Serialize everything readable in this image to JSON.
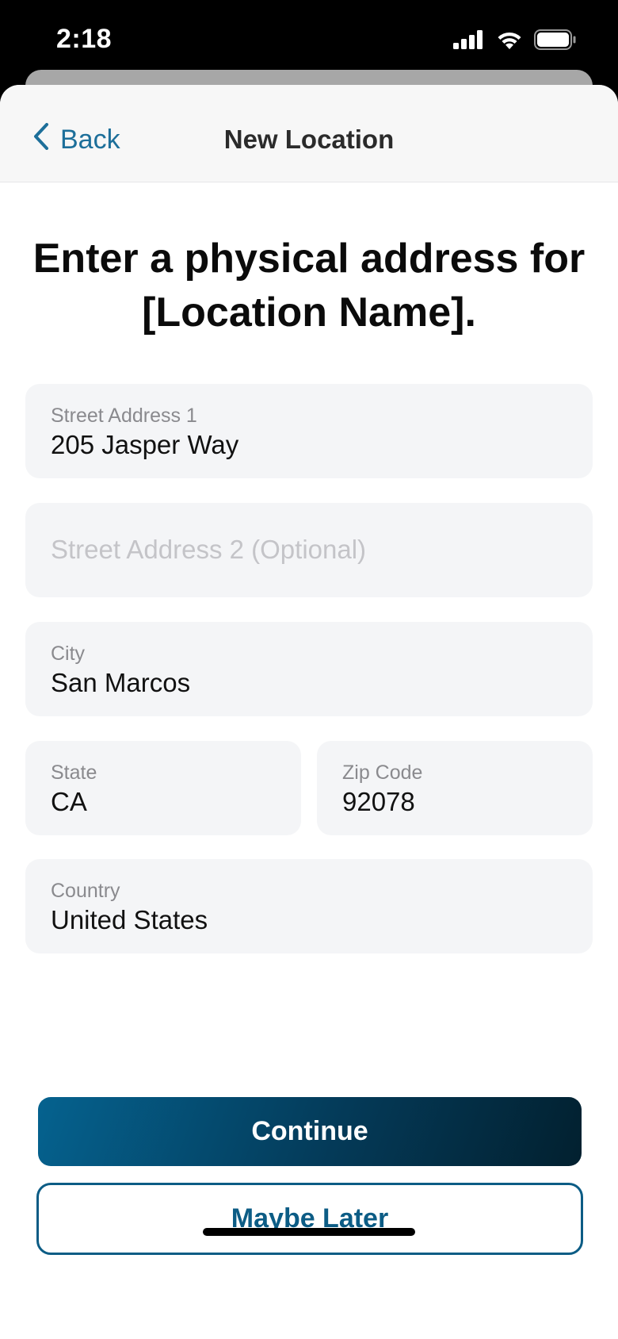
{
  "status_bar": {
    "time": "2:18",
    "icons": [
      "cellular-signal-icon",
      "wifi-icon",
      "battery-icon"
    ]
  },
  "nav": {
    "back_label": "Back",
    "title": "New Location"
  },
  "heading": "Enter a physical address for [Location Name].",
  "form": {
    "street1": {
      "label": "Street Address 1",
      "value": "205 Jasper Way"
    },
    "street2": {
      "placeholder": "Street Address 2 (Optional)",
      "value": ""
    },
    "city": {
      "label": "City",
      "value": "San Marcos"
    },
    "state": {
      "label": "State",
      "value": "CA"
    },
    "zip": {
      "label": "Zip Code",
      "value": "92078"
    },
    "country": {
      "label": "Country",
      "value": "United States"
    }
  },
  "actions": {
    "continue_label": "Continue",
    "later_label": "Maybe Later"
  },
  "colors": {
    "accent": "#1d6f9a",
    "primary_button_start": "#05628f",
    "primary_button_end": "#02202f",
    "field_background": "#f4f5f7"
  }
}
